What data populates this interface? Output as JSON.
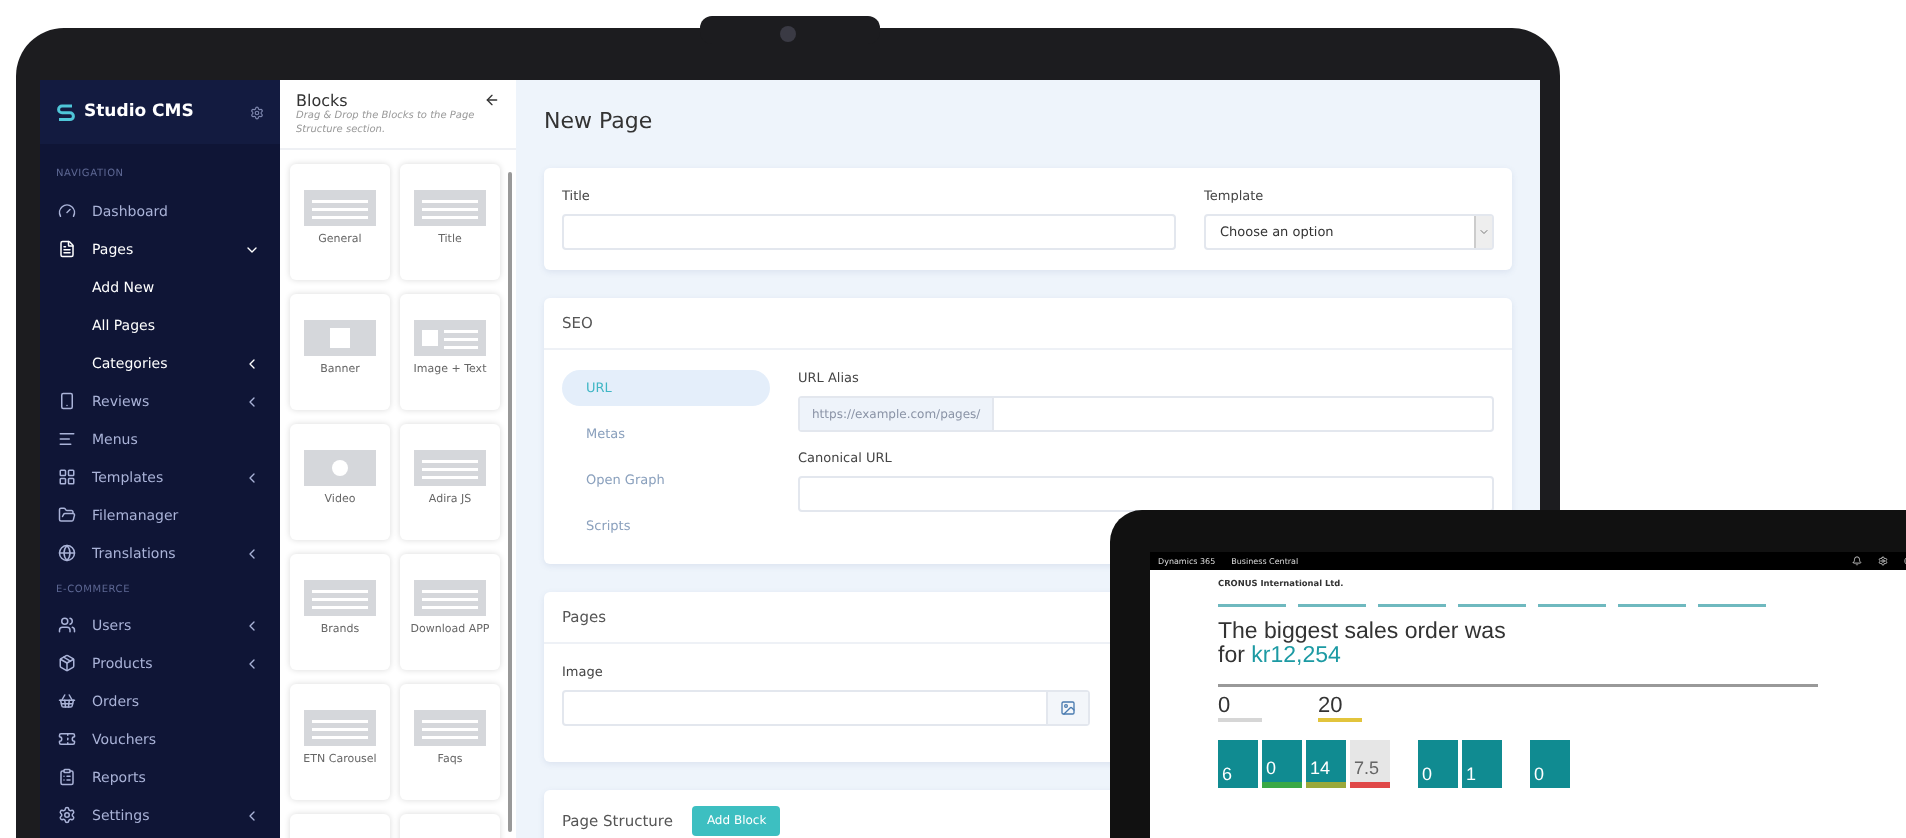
{
  "sidebar": {
    "brand": "Studio CMS",
    "sections": [
      {
        "heading": "NAVIGATION",
        "items": [
          {
            "label": "Dashboard",
            "selected": false
          },
          {
            "label": "Pages",
            "selected": true,
            "expanded": true,
            "children": [
              {
                "label": "Add New"
              },
              {
                "label": "All Pages"
              },
              {
                "label": "Categories",
                "expanded": false
              }
            ]
          },
          {
            "label": "Reviews",
            "selected": false,
            "expanded": false
          },
          {
            "label": "Menus",
            "selected": false
          },
          {
            "label": "Templates",
            "selected": false,
            "expanded": false
          },
          {
            "label": "Filemanager",
            "selected": false
          },
          {
            "label": "Translations",
            "selected": false,
            "expanded": false
          }
        ]
      },
      {
        "heading": "E-COMMERCE",
        "items": [
          {
            "label": "Users",
            "selected": false,
            "expanded": false
          },
          {
            "label": "Products",
            "selected": false,
            "expanded": false
          },
          {
            "label": "Orders",
            "selected": false
          },
          {
            "label": "Vouchers",
            "selected": false
          },
          {
            "label": "Reports",
            "selected": false
          },
          {
            "label": "Settings",
            "selected": false,
            "expanded": false
          }
        ]
      }
    ]
  },
  "blocks": {
    "title": "Blocks",
    "hint": "Drag & Drop the Blocks to the Page Structure section.",
    "items": [
      {
        "label": "General",
        "kind": "lines"
      },
      {
        "label": "Title",
        "kind": "lines"
      },
      {
        "label": "Banner",
        "kind": "image"
      },
      {
        "label": "Image + Text",
        "kind": "image-text"
      },
      {
        "label": "Video",
        "kind": "video"
      },
      {
        "label": "Adira JS",
        "kind": "lines"
      },
      {
        "label": "Brands",
        "kind": "lines"
      },
      {
        "label": "Download APP",
        "kind": "lines"
      },
      {
        "label": "ETN Carousel",
        "kind": "lines"
      },
      {
        "label": "Faqs",
        "kind": "lines"
      }
    ]
  },
  "main": {
    "title": "New Page",
    "general": {
      "title_label": "Title",
      "template_label": "Template",
      "template_value": "Choose an option"
    },
    "seo": {
      "heading": "SEO",
      "tabs": [
        {
          "label": "URL",
          "selected": true
        },
        {
          "label": "Metas",
          "selected": false
        },
        {
          "label": "Open Graph",
          "selected": false
        },
        {
          "label": "Scripts",
          "selected": false
        }
      ],
      "alias_label": "URL Alias",
      "alias_prefix": "https://example.com/pages/",
      "canonical_label": "Canonical URL"
    },
    "pages": {
      "heading": "Pages",
      "image_label": "Image"
    },
    "structure": {
      "heading": "Page Structure",
      "button": "Add Block"
    }
  },
  "tablet": {
    "app": "Dynamics 365",
    "product": "Business Central",
    "company": "CRONUS International Ltd.",
    "headline": "The biggest sales order was for",
    "amount": "kr12,254",
    "kpis": [
      {
        "value": "0",
        "color": "#d6d6d6"
      },
      {
        "value": "20",
        "color": "#e2c43c"
      }
    ],
    "tile_groups": [
      {
        "tiles": [
          {
            "value": "6",
            "kind": "teal"
          },
          {
            "value": "0",
            "kind": "teal",
            "color": "#3aa845"
          },
          {
            "value": "14",
            "kind": "teal",
            "color": "#9aa83a"
          },
          {
            "value": "7.5",
            "kind": "grey",
            "color": "#e04848"
          }
        ]
      },
      {
        "tiles": [
          {
            "value": "0",
            "kind": "teal"
          },
          {
            "value": "1",
            "kind": "teal"
          }
        ]
      },
      {
        "tiles": [
          {
            "value": "0",
            "kind": "teal"
          }
        ]
      }
    ]
  }
}
